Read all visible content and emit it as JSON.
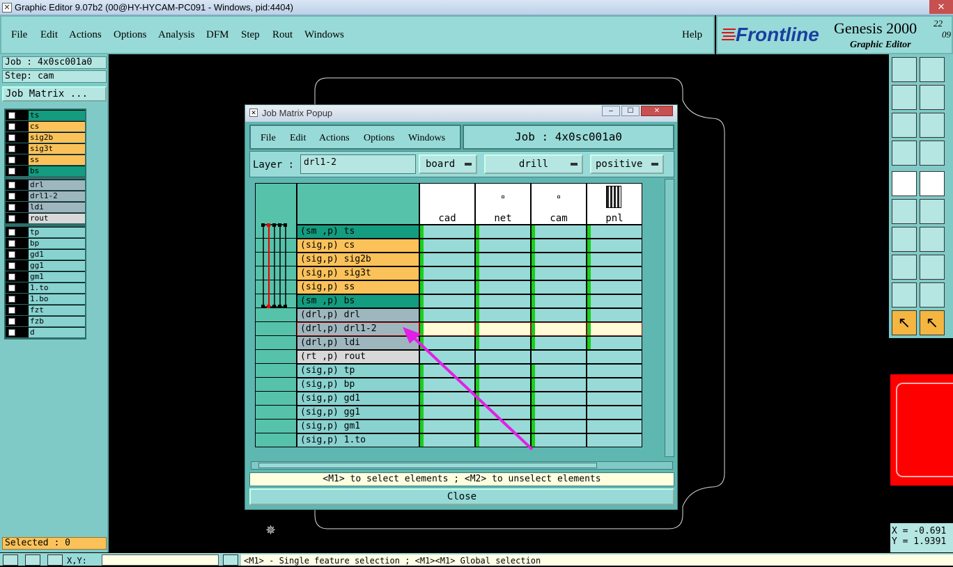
{
  "window": {
    "title": "Graphic Editor 9.07b2 (00@HY-HYCAM-PC091 - Windows, pid:4404)",
    "close_glyph": "✕"
  },
  "menu": {
    "items": [
      "File",
      "Edit",
      "Actions",
      "Options",
      "Analysis",
      "DFM",
      "Step",
      "Rout",
      "Windows"
    ],
    "help": "Help"
  },
  "logo": {
    "brand": "Frontline",
    "product": "Genesis 2000",
    "subtitle": "Graphic Editor",
    "date_top": "22",
    "date_bottom": "09"
  },
  "left": {
    "job": "Job : 4x0sc001a0",
    "step": "Step: cam",
    "job_matrix_button": "Job Matrix ...",
    "selected": "Selected : 0"
  },
  "layers": {
    "group1": [
      {
        "name": "ts",
        "color": "#139c7f"
      },
      {
        "name": "cs",
        "color": "#fbc25a"
      },
      {
        "name": "sig2b",
        "color": "#fbc25a"
      },
      {
        "name": "sig3t",
        "color": "#fbc25a"
      },
      {
        "name": "ss",
        "color": "#fbc25a"
      },
      {
        "name": "bs",
        "color": "#139c7f"
      }
    ],
    "group2": [
      {
        "name": "drl",
        "color": "#9eb7bf"
      },
      {
        "name": "drl1-2",
        "color": "#9eb7bf"
      },
      {
        "name": "ldi",
        "color": "#9eb7bf"
      },
      {
        "name": "rout",
        "color": "#d8d8d8"
      }
    ],
    "group3": [
      {
        "name": "tp",
        "color": "#88d2d0"
      },
      {
        "name": "bp",
        "color": "#88d2d0"
      },
      {
        "name": "gd1",
        "color": "#88d2d0"
      },
      {
        "name": "gg1",
        "color": "#88d2d0"
      },
      {
        "name": "gm1",
        "color": "#88d2d0"
      },
      {
        "name": "1.to",
        "color": "#88d2d0"
      },
      {
        "name": "1.bo",
        "color": "#88d2d0"
      },
      {
        "name": "fzt",
        "color": "#88d2d0"
      },
      {
        "name": "fzb",
        "color": "#88d2d0"
      },
      {
        "name": "d",
        "color": "#88d2d0"
      }
    ]
  },
  "popup": {
    "title": "Job Matrix Popup",
    "menu": [
      "File",
      "Edit",
      "Actions",
      "Options",
      "Windows"
    ],
    "job_label": "Job : 4x0sc001a0",
    "layer_label": "Layer :",
    "layer_value": "drl1-2",
    "context": "board",
    "type": "drill",
    "polarity": "positive",
    "columns": [
      "cad",
      "net",
      "cam",
      "pnl"
    ],
    "rows": [
      {
        "label": "(sm ,p) ts",
        "color": "#139c7f"
      },
      {
        "label": "(sig,p) cs",
        "color": "#fbc25a"
      },
      {
        "label": "(sig,p) sig2b",
        "color": "#fbc25a"
      },
      {
        "label": "(sig,p) sig3t",
        "color": "#fbc25a"
      },
      {
        "label": "(sig,p) ss",
        "color": "#fbc25a"
      },
      {
        "label": "(sm ,p) bs",
        "color": "#139c7f"
      },
      {
        "label": "(drl,p) drl",
        "color": "#9eb7bf"
      },
      {
        "label": "(drl,p) drl1-2",
        "color": "#9eb7bf",
        "selected": true
      },
      {
        "label": "(drl,p) ldi",
        "color": "#9eb7bf"
      },
      {
        "label": "(rt ,p) rout",
        "color": "#d8d8d8"
      },
      {
        "label": "(sig,p) tp",
        "color": "#88d2d0"
      },
      {
        "label": "(sig,p) bp",
        "color": "#88d2d0"
      },
      {
        "label": "(sig,p) gd1",
        "color": "#88d2d0"
      },
      {
        "label": "(sig,p) gg1",
        "color": "#88d2d0"
      },
      {
        "label": "(sig,p) gm1",
        "color": "#88d2d0"
      },
      {
        "label": "(sig,p) 1.to",
        "color": "#88d2d0"
      }
    ],
    "hint": "<M1> to select elements ; <M2> to unselect elements",
    "close": "Close"
  },
  "coords": {
    "x": "X = -0.691",
    "y": "Y = 1.9391"
  },
  "statusbar": {
    "xy_label": "X,Y:",
    "message": "<M1> - Single feature selection ; <M1><M1> Global selection"
  }
}
